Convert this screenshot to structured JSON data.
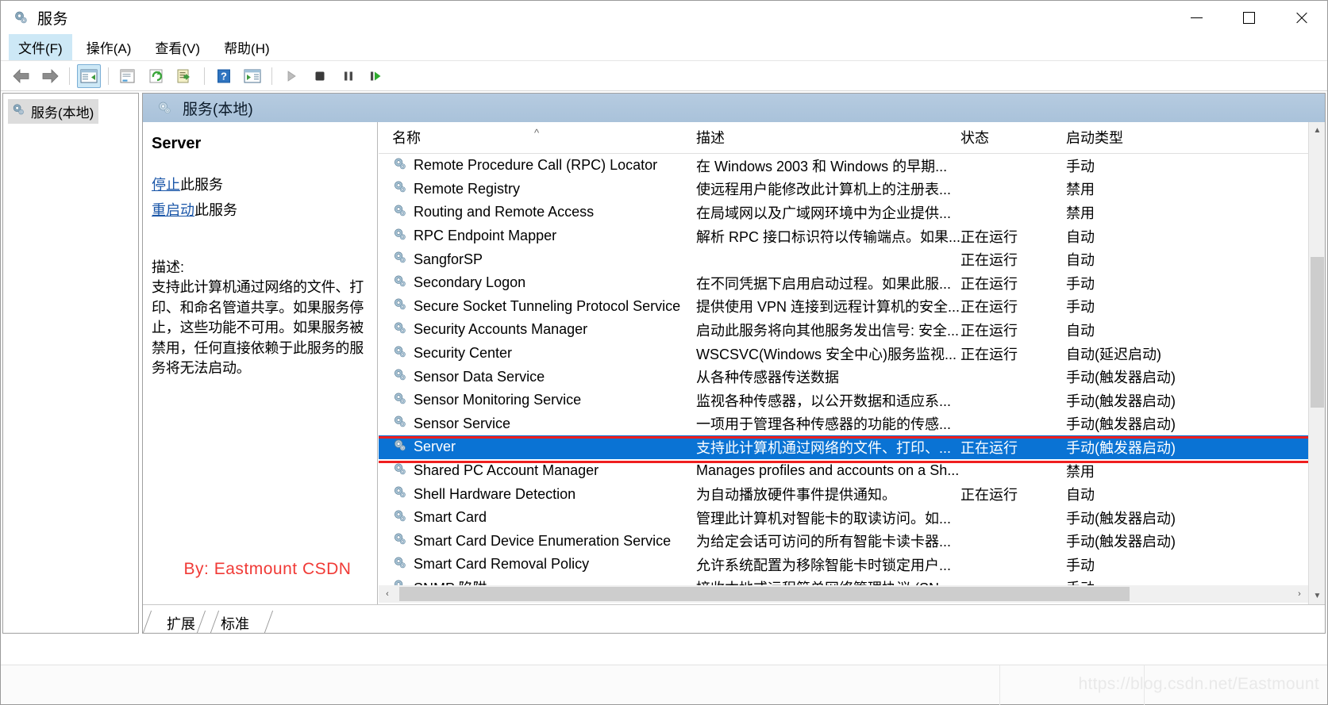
{
  "window": {
    "title": "服务",
    "icon": "services-gear-icon",
    "minimize_label": "最小化",
    "maximize_label": "最大化",
    "close_label": "关闭"
  },
  "menubar": {
    "items": [
      {
        "label": "文件(F)",
        "name": "menu-file",
        "active": true
      },
      {
        "label": "操作(A)",
        "name": "menu-action",
        "active": false
      },
      {
        "label": "查看(V)",
        "name": "menu-view",
        "active": false
      },
      {
        "label": "帮助(H)",
        "name": "menu-help",
        "active": false
      }
    ]
  },
  "toolbar": {
    "buttons": [
      {
        "name": "back-arrow-icon",
        "icon": "arrow-left",
        "selected": false
      },
      {
        "name": "forward-arrow-icon",
        "icon": "arrow-right",
        "selected": false
      },
      {
        "name": "show-hide-tree-icon",
        "icon": "console-tree",
        "selected": true
      },
      {
        "name": "properties-icon",
        "icon": "properties",
        "selected": false
      },
      {
        "name": "refresh-icon",
        "icon": "refresh",
        "selected": false
      },
      {
        "name": "export-list-icon",
        "icon": "export-list",
        "selected": false
      },
      {
        "name": "help-icon",
        "icon": "help",
        "selected": false
      },
      {
        "name": "show-action-pane-icon",
        "icon": "action-pane",
        "selected": false
      },
      {
        "name": "start-service-icon",
        "icon": "play",
        "selected": false
      },
      {
        "name": "stop-service-icon",
        "icon": "stop",
        "selected": false
      },
      {
        "name": "pause-service-icon",
        "icon": "pause",
        "selected": false
      },
      {
        "name": "restart-service-icon",
        "icon": "restart",
        "selected": false
      }
    ]
  },
  "sidebar": {
    "root": {
      "label": "服务(本地)",
      "icon": "services-gear-icon",
      "selected": true
    }
  },
  "content_header": {
    "title": "服务(本地)",
    "icon": "services-gear-icon"
  },
  "details": {
    "service_name": "Server",
    "stop_link": "停止",
    "stop_suffix": "此服务",
    "restart_link": "重启动",
    "restart_suffix": "此服务",
    "description_label": "描述:",
    "description_text": "支持此计算机通过网络的文件、打印、和命名管道共享。如果服务停止，这些功能不可用。如果服务被禁用，任何直接依赖于此服务的服务将无法启动。",
    "byline": "By: Eastmount CSDN"
  },
  "list": {
    "columns": [
      "名称",
      "描述",
      "状态",
      "启动类型"
    ],
    "sort_indicator": "^",
    "rows": [
      {
        "name": "Remote Procedure Call (RPC) Locator",
        "description": "在 Windows 2003 和 Windows 的早期...",
        "status": "",
        "startup": "手动",
        "selected": false
      },
      {
        "name": "Remote Registry",
        "description": "使远程用户能修改此计算机上的注册表...",
        "status": "",
        "startup": "禁用",
        "selected": false
      },
      {
        "name": "Routing and Remote Access",
        "description": "在局域网以及广域网环境中为企业提供...",
        "status": "",
        "startup": "禁用",
        "selected": false
      },
      {
        "name": "RPC Endpoint Mapper",
        "description": "解析 RPC 接口标识符以传输端点。如果...",
        "status": "正在运行",
        "startup": "自动",
        "selected": false
      },
      {
        "name": "SangforSP",
        "description": "",
        "status": "正在运行",
        "startup": "自动",
        "selected": false
      },
      {
        "name": "Secondary Logon",
        "description": "在不同凭据下启用启动过程。如果此服...",
        "status": "正在运行",
        "startup": "手动",
        "selected": false
      },
      {
        "name": "Secure Socket Tunneling Protocol Service",
        "description": "提供使用 VPN 连接到远程计算机的安全...",
        "status": "正在运行",
        "startup": "手动",
        "selected": false
      },
      {
        "name": "Security Accounts Manager",
        "description": "启动此服务将向其他服务发出信号: 安全...",
        "status": "正在运行",
        "startup": "自动",
        "selected": false
      },
      {
        "name": "Security Center",
        "description": "WSCSVC(Windows 安全中心)服务监视...",
        "status": "正在运行",
        "startup": "自动(延迟启动)",
        "selected": false
      },
      {
        "name": "Sensor Data Service",
        "description": "从各种传感器传送数据",
        "status": "",
        "startup": "手动(触发器启动)",
        "selected": false
      },
      {
        "name": "Sensor Monitoring Service",
        "description": "监视各种传感器，以公开数据和适应系...",
        "status": "",
        "startup": "手动(触发器启动)",
        "selected": false
      },
      {
        "name": "Sensor Service",
        "description": "一项用于管理各种传感器的功能的传感...",
        "status": "",
        "startup": "手动(触发器启动)",
        "selected": false
      },
      {
        "name": "Server",
        "description": "支持此计算机通过网络的文件、打印、...",
        "status": "正在运行",
        "startup": "手动(触发器启动)",
        "selected": true
      },
      {
        "name": "Shared PC Account Manager",
        "description": "Manages profiles and accounts on a Sh...",
        "status": "",
        "startup": "禁用",
        "selected": false
      },
      {
        "name": "Shell Hardware Detection",
        "description": "为自动播放硬件事件提供通知。",
        "status": "正在运行",
        "startup": "自动",
        "selected": false
      },
      {
        "name": "Smart Card",
        "description": "管理此计算机对智能卡的取读访问。如...",
        "status": "",
        "startup": "手动(触发器启动)",
        "selected": false
      },
      {
        "name": "Smart Card Device Enumeration Service",
        "description": "为给定会话可访问的所有智能卡读卡器...",
        "status": "",
        "startup": "手动(触发器启动)",
        "selected": false
      },
      {
        "name": "Smart Card Removal Policy",
        "description": "允许系统配置为移除智能卡时锁定用户...",
        "status": "",
        "startup": "手动",
        "selected": false
      },
      {
        "name": "SNMP 陷阱",
        "description": "接收本地或远程简单网络管理协议 (SN...",
        "status": "",
        "startup": "手动",
        "selected": false
      }
    ]
  },
  "tabs": [
    {
      "label": "扩展",
      "name": "tab-extended",
      "active": false
    },
    {
      "label": "标准",
      "name": "tab-standard",
      "active": true
    }
  ],
  "scrollbars": {
    "up_arrow": "▲",
    "down_arrow": "▼",
    "left_arrow": "‹",
    "right_arrow": "›"
  },
  "watermark": "https://blog.csdn.net/Eastmount",
  "colors": {
    "selection_blue": "#0a73d4",
    "highlight_red": "#ef1f1f",
    "byline_red": "#f03a36",
    "link_blue": "#1a56a8",
    "header_band": "#a9c2da"
  }
}
